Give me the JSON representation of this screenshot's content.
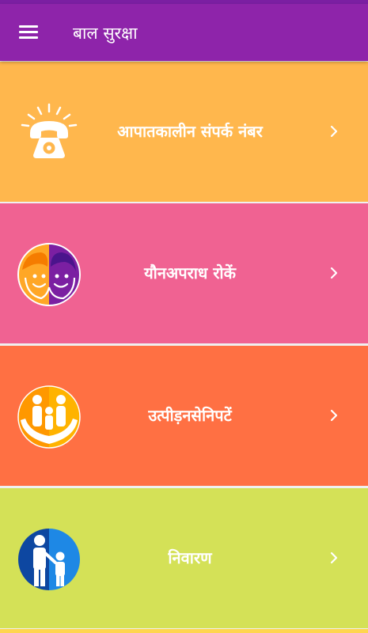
{
  "colors": {
    "status_bar": "#7b1fa2",
    "app_bar": "#8e24aa",
    "card_1": "#ffb74d",
    "card_2": "#f06292",
    "card_3": "#ff7043",
    "card_4": "#d4e157",
    "text": "#ffffff"
  },
  "app_bar": {
    "menu_icon": "hamburger-menu-icon",
    "title": "बाल सुरक्षा"
  },
  "cards": [
    {
      "label": "आपातकालीन संपर्क नंबर",
      "icon": "ringing-telephone-icon",
      "chevron": "chevron-right-icon"
    },
    {
      "label": "यौनअपराध रोकें",
      "icon": "child-faces-icon",
      "chevron": "chevron-right-icon"
    },
    {
      "label": "उत्पीड़नसेनिपटें",
      "icon": "family-protection-hands-icon",
      "chevron": "chevron-right-icon"
    },
    {
      "label": "निवारण",
      "icon": "parent-child-icon",
      "chevron": "chevron-right-icon"
    }
  ]
}
